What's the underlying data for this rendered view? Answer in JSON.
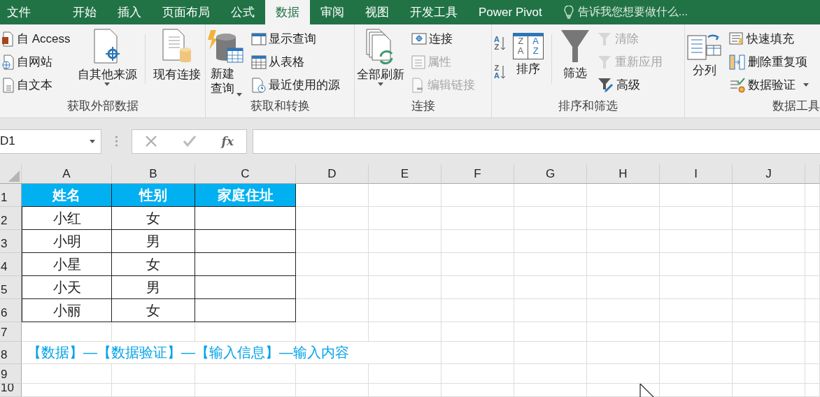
{
  "tabs": [
    {
      "label": "文件",
      "selected": false
    },
    {
      "label": "开始",
      "selected": false
    },
    {
      "label": "插入",
      "selected": false
    },
    {
      "label": "页面布局",
      "selected": false
    },
    {
      "label": "公式",
      "selected": false
    },
    {
      "label": "数据",
      "selected": true
    },
    {
      "label": "审阅",
      "selected": false
    },
    {
      "label": "视图",
      "selected": false
    },
    {
      "label": "开发工具",
      "selected": false
    },
    {
      "label": "Power Pivot",
      "selected": false
    }
  ],
  "tell_me": {
    "placeholder": "告诉我您想要做什么..."
  },
  "ribbon": {
    "groups": [
      {
        "label": "获取外部数据",
        "columns": [
          {
            "kind": "stack",
            "items": [
              {
                "label": "自 Access",
                "disabled": false
              },
              {
                "label": "自网站",
                "disabled": false
              },
              {
                "label": "自文本",
                "disabled": false
              }
            ]
          },
          {
            "kind": "large",
            "label": "自其他来源",
            "caret": true,
            "disabled": false
          },
          {
            "kind": "separator"
          },
          {
            "kind": "large",
            "label": "现有连接",
            "caret": false,
            "disabled": false
          }
        ]
      },
      {
        "label": "获取和转换",
        "columns": [
          {
            "kind": "tall",
            "label": "新建查询",
            "caret": true,
            "disabled": false
          },
          {
            "kind": "stack",
            "items": [
              {
                "label": "显示查询",
                "disabled": false
              },
              {
                "label": "从表格",
                "disabled": false
              },
              {
                "label": "最近使用的源",
                "disabled": false
              }
            ]
          }
        ]
      },
      {
        "label": "连接",
        "columns": [
          {
            "kind": "large",
            "label": "全部刷新",
            "caret": true,
            "disabled": false
          },
          {
            "kind": "stack",
            "items": [
              {
                "label": "连接",
                "disabled": false
              },
              {
                "label": "属性",
                "disabled": true
              },
              {
                "label": "编辑链接",
                "disabled": true
              }
            ]
          }
        ]
      },
      {
        "label": "排序和筛选",
        "columns": [
          {
            "kind": "iconstack",
            "items": [
              {
                "glyphs": [
                  "A",
                  "Z"
                ],
                "disabled": false
              },
              {
                "glyphs": [
                  "Z",
                  "A"
                ],
                "disabled": false
              }
            ]
          },
          {
            "kind": "large",
            "label": "排序",
            "glyphs": [
              "Z",
              "A",
              "A",
              "Z"
            ],
            "caret": false,
            "disabled": false
          },
          {
            "kind": "separator"
          },
          {
            "kind": "large",
            "label": "筛选",
            "caret": false,
            "disabled": false
          },
          {
            "kind": "stack",
            "items": [
              {
                "label": "清除",
                "disabled": true
              },
              {
                "label": "重新应用",
                "disabled": true
              },
              {
                "label": "高级",
                "disabled": false
              }
            ]
          }
        ]
      },
      {
        "label": "数据工具",
        "columns": [
          {
            "kind": "large",
            "label": "分列",
            "caret": false,
            "disabled": false
          },
          {
            "kind": "stack",
            "items": [
              {
                "label": "快速填充",
                "disabled": false
              },
              {
                "label": "删除重复项",
                "disabled": false
              },
              {
                "label": "数据验证",
                "disabled": false,
                "caret": true
              }
            ]
          }
        ]
      }
    ]
  },
  "formula_bar": {
    "name_box": "D1",
    "function_label": "fx"
  },
  "sheet": {
    "columns": [
      "A",
      "B",
      "C",
      "D",
      "E",
      "F",
      "G",
      "H",
      "I",
      "J"
    ],
    "rows": [
      {
        "number": "1",
        "kind": "header",
        "cells": [
          "姓名",
          "性别",
          "家庭住址"
        ]
      },
      {
        "number": "2",
        "kind": "data",
        "cells": [
          "小红",
          "女"
        ]
      },
      {
        "number": "3",
        "kind": "data",
        "cells": [
          "小明",
          "男"
        ]
      },
      {
        "number": "4",
        "kind": "data",
        "cells": [
          "小星",
          "女"
        ]
      },
      {
        "number": "5",
        "kind": "data",
        "cells": [
          "小天",
          "男"
        ]
      },
      {
        "number": "6",
        "kind": "data",
        "cells": [
          "小丽",
          "女"
        ]
      },
      {
        "number": "7",
        "kind": "blank"
      },
      {
        "number": "8",
        "kind": "note",
        "text": "【数据】—【数据验证】—【输入信息】—输入内容"
      },
      {
        "number": "9",
        "kind": "blank"
      },
      {
        "number": "10",
        "kind": "blank"
      }
    ]
  }
}
